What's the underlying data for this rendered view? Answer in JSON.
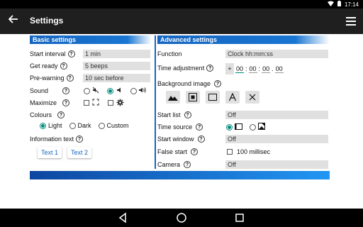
{
  "status": {
    "time": "17:14"
  },
  "appbar": {
    "title": "Settings",
    "back_icon": "back-arrow-icon",
    "menu_icon": "hamburger-menu-icon"
  },
  "basic": {
    "header": "Basic settings",
    "start_interval": {
      "label": "Start interval",
      "value": "1 min"
    },
    "get_ready": {
      "label": "Get ready",
      "value": "5 beeps"
    },
    "pre_warning": {
      "label": "Pre-warning",
      "value": "10 sec before"
    },
    "sound": {
      "label": "Sound",
      "selected": "low"
    },
    "maximize": {
      "label": "Maximize"
    },
    "colours": {
      "label": "Colours",
      "options": [
        "Light",
        "Dark",
        "Custom"
      ],
      "selected": "Light"
    },
    "info_text": {
      "label": "Information text",
      "btn1": "Text 1",
      "btn2": "Text 2"
    }
  },
  "advanced": {
    "header": "Advanced settings",
    "function": {
      "label": "Function",
      "value": "Clock hh:mm:ss"
    },
    "time_adjustment": {
      "label": "Time adjustment",
      "sign": "+",
      "hh": "00",
      "mm": "00",
      "ss": "00",
      "cs": "00"
    },
    "background_image": {
      "label": "Background image"
    },
    "start_list": {
      "label": "Start list",
      "value": "Off"
    },
    "time_source": {
      "label": "Time source",
      "selected": "screen"
    },
    "start_window": {
      "label": "Start window",
      "value": "Off"
    },
    "false_start": {
      "label": "False start",
      "value": "100 millisec",
      "checked": false
    },
    "camera": {
      "label": "Camera",
      "value": "Off"
    }
  },
  "colors": {
    "accent": "#1565c0",
    "radio": "#00897b",
    "field_bg": "#e0e0e0"
  }
}
